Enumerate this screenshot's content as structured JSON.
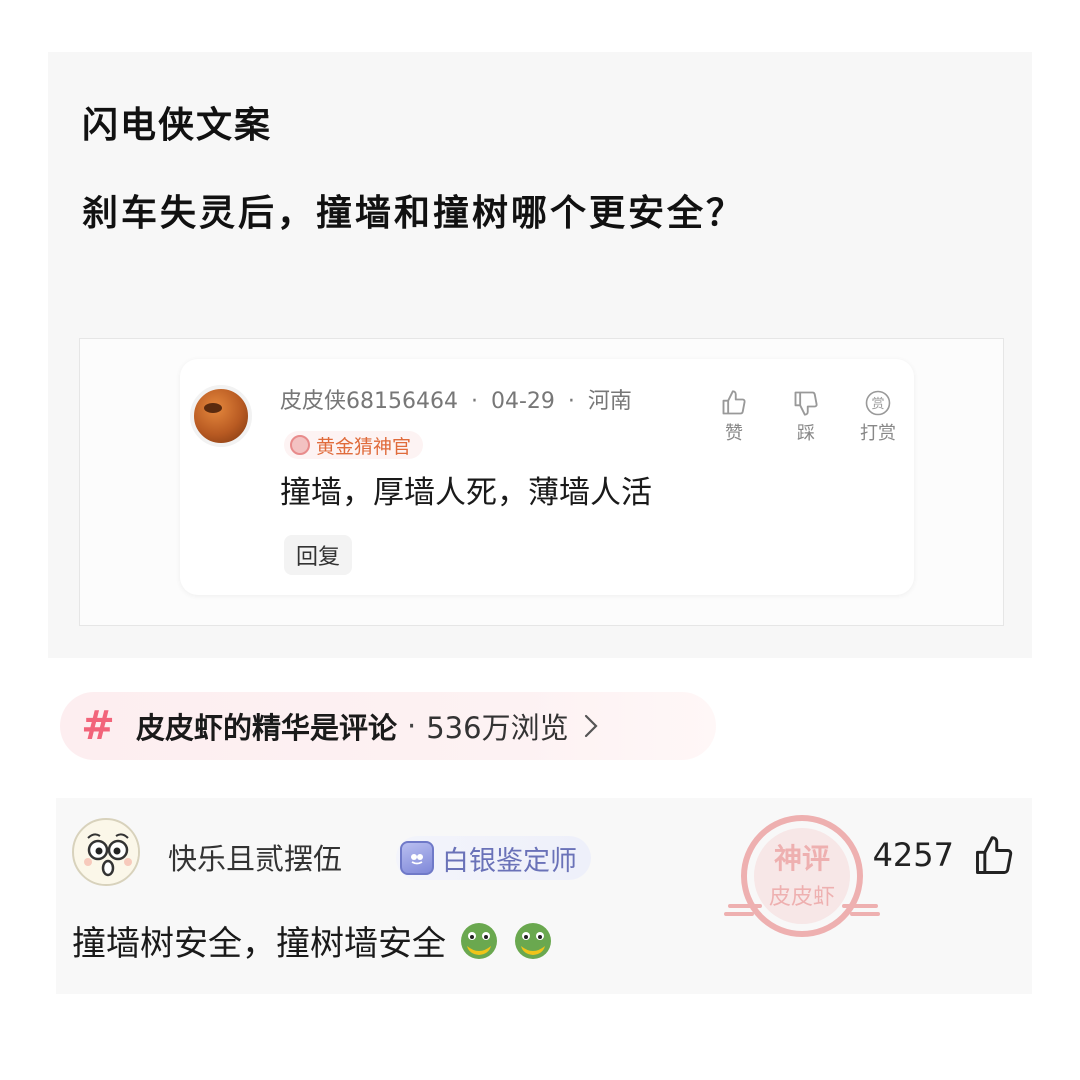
{
  "post": {
    "subtitle": "闪电侠文案",
    "title": "刹车失灵后，撞墙和撞树哪个更安全？"
  },
  "embedded_comment": {
    "username": "皮皮侠68156464",
    "date": "04-29",
    "location": "河南",
    "dot": "·",
    "badge": "黄金猜神官",
    "text": "撞墙，厚墙人死，薄墙人活",
    "reply_label": "回复",
    "actions": {
      "like_label": "赞",
      "dislike_label": "踩",
      "tip_label": "打赏",
      "tip_icon_char": "赏"
    }
  },
  "topic": {
    "hash": "#",
    "name": "皮皮虾的精华是评论",
    "separator": "·",
    "views": "536万浏览"
  },
  "comment": {
    "username": "快乐且贰摆伍",
    "badge": "白银鉴定师",
    "like_count": "4257",
    "text": "撞墙树安全，撞树墙安全"
  },
  "watermark": {
    "line1": "神评",
    "line2": "皮皮虾"
  },
  "colors": {
    "topic_accent": "#f2647a",
    "gold_badge": "#e06b3b",
    "silver_badge": "#6a72b8",
    "stamp_red": "#e35a5a"
  }
}
